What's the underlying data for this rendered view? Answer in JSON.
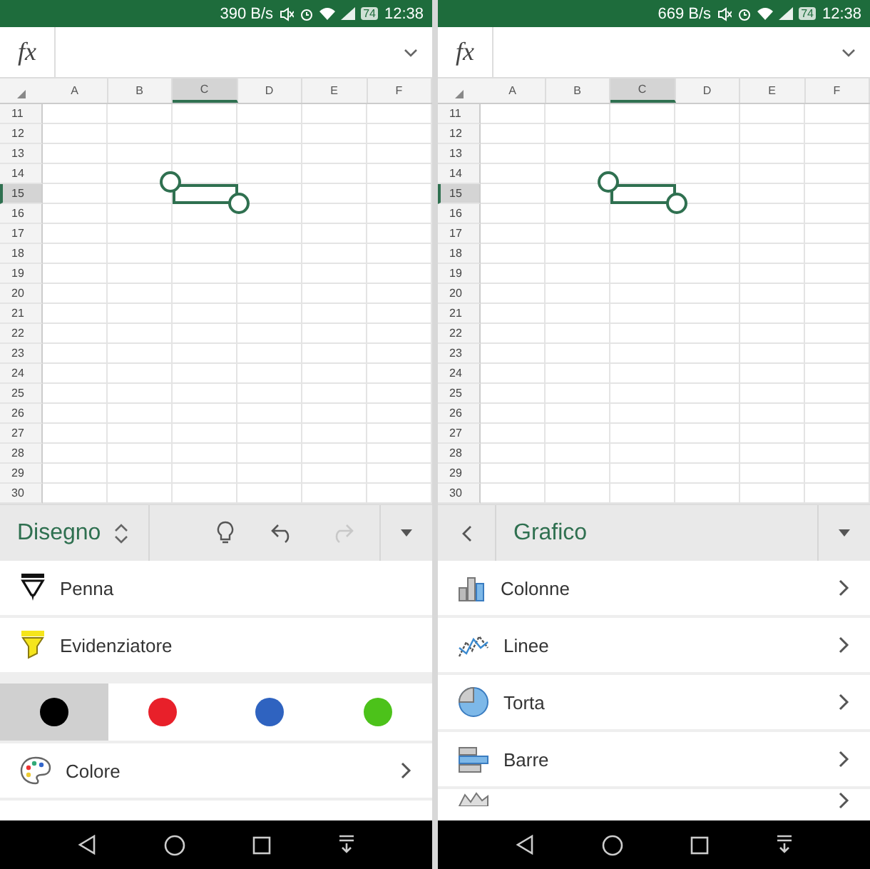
{
  "panes": [
    {
      "status_bar": {
        "speed": "390 B/s",
        "battery": "74",
        "time": "12:38"
      },
      "formula_bar": {
        "fx_label": "fx"
      },
      "columns": [
        {
          "label": "A",
          "selected": false
        },
        {
          "label": "B",
          "selected": false
        },
        {
          "label": "C",
          "selected": true
        },
        {
          "label": "D",
          "selected": false
        },
        {
          "label": "E",
          "selected": false
        },
        {
          "label": "F",
          "selected": false
        }
      ],
      "rows": [
        {
          "label": "11",
          "selected": false
        },
        {
          "label": "12",
          "selected": false
        },
        {
          "label": "13",
          "selected": false
        },
        {
          "label": "14",
          "selected": false
        },
        {
          "label": "15",
          "selected": true
        },
        {
          "label": "16",
          "selected": false
        },
        {
          "label": "17",
          "selected": false
        },
        {
          "label": "18",
          "selected": false
        },
        {
          "label": "19",
          "selected": false
        },
        {
          "label": "20",
          "selected": false
        },
        {
          "label": "21",
          "selected": false
        },
        {
          "label": "22",
          "selected": false
        },
        {
          "label": "23",
          "selected": false
        },
        {
          "label": "24",
          "selected": false
        },
        {
          "label": "25",
          "selected": false
        },
        {
          "label": "26",
          "selected": false
        },
        {
          "label": "27",
          "selected": false
        },
        {
          "label": "28",
          "selected": false
        },
        {
          "label": "29",
          "selected": false
        },
        {
          "label": "30",
          "selected": false
        }
      ],
      "toolbar": {
        "kind": "draw",
        "title": "Disegno",
        "redo_disabled": true
      },
      "items": [
        {
          "kind": "pen",
          "label": "Penna"
        },
        {
          "kind": "highlighter",
          "label": "Evidenziatore"
        },
        {
          "kind": "swatches",
          "swatches": [
            {
              "color": "#000000",
              "selected": true
            },
            {
              "color": "#e8202a",
              "selected": false
            },
            {
              "color": "#2f63c0",
              "selected": false
            },
            {
              "color": "#4cc21a",
              "selected": false
            }
          ]
        },
        {
          "kind": "palette",
          "label": "Colore"
        }
      ]
    },
    {
      "status_bar": {
        "speed": "669 B/s",
        "battery": "74",
        "time": "12:38"
      },
      "formula_bar": {
        "fx_label": "fx"
      },
      "columns": [
        {
          "label": "A",
          "selected": false
        },
        {
          "label": "B",
          "selected": false
        },
        {
          "label": "C",
          "selected": true
        },
        {
          "label": "D",
          "selected": false
        },
        {
          "label": "E",
          "selected": false
        },
        {
          "label": "F",
          "selected": false
        }
      ],
      "rows": [
        {
          "label": "11",
          "selected": false
        },
        {
          "label": "12",
          "selected": false
        },
        {
          "label": "13",
          "selected": false
        },
        {
          "label": "14",
          "selected": false
        },
        {
          "label": "15",
          "selected": true
        },
        {
          "label": "16",
          "selected": false
        },
        {
          "label": "17",
          "selected": false
        },
        {
          "label": "18",
          "selected": false
        },
        {
          "label": "19",
          "selected": false
        },
        {
          "label": "20",
          "selected": false
        },
        {
          "label": "21",
          "selected": false
        },
        {
          "label": "22",
          "selected": false
        },
        {
          "label": "23",
          "selected": false
        },
        {
          "label": "24",
          "selected": false
        },
        {
          "label": "25",
          "selected": false
        },
        {
          "label": "26",
          "selected": false
        },
        {
          "label": "27",
          "selected": false
        },
        {
          "label": "28",
          "selected": false
        },
        {
          "label": "29",
          "selected": false
        },
        {
          "label": "30",
          "selected": false
        }
      ],
      "toolbar": {
        "kind": "back",
        "title": "Grafico"
      },
      "items": [
        {
          "kind": "columns",
          "label": "Colonne"
        },
        {
          "kind": "lines",
          "label": "Linee"
        },
        {
          "kind": "pie",
          "label": "Torta"
        },
        {
          "kind": "bars",
          "label": "Barre"
        },
        {
          "kind": "area"
        }
      ]
    }
  ]
}
